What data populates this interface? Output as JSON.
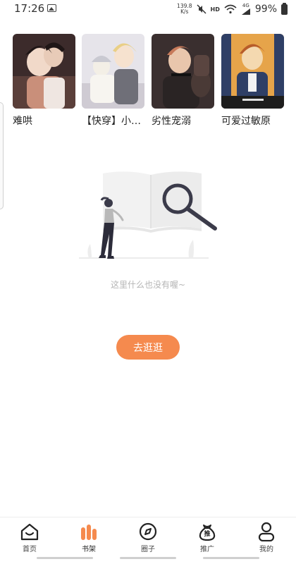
{
  "status_bar": {
    "time": "17:26",
    "net_speed_value": "139.8",
    "net_speed_unit": "K/s",
    "hd": "HD",
    "network": "4G",
    "battery": "99%"
  },
  "shelf": {
    "books": [
      {
        "title": "难哄",
        "cover_palette": [
          "#3c2b2b",
          "#c98f7a",
          "#f1d9c9"
        ]
      },
      {
        "title": "【快穿】小…",
        "cover_palette": [
          "#d9d9e2",
          "#f3efe6",
          "#6f6f78"
        ]
      },
      {
        "title": "劣性宠溺",
        "cover_palette": [
          "#3a2f2f",
          "#c77a5a",
          "#e9c6ac"
        ]
      },
      {
        "title": "可爱过敏原",
        "cover_palette": [
          "#2f3f66",
          "#e6a44a",
          "#f4d9b0"
        ]
      }
    ]
  },
  "empty_state": {
    "text": "这里什么也没有喔~",
    "button_label": "去逛逛"
  },
  "tab_bar": {
    "active_color": "#f58a4e",
    "tabs": [
      {
        "label": "首页",
        "icon": "home-icon"
      },
      {
        "label": "书架",
        "icon": "bookshelf-icon",
        "active": true
      },
      {
        "label": "圈子",
        "icon": "compass-icon"
      },
      {
        "label": "推广",
        "icon": "promo-bag-icon",
        "icon_text": "推"
      },
      {
        "label": "我的",
        "icon": "profile-icon"
      }
    ]
  },
  "colors": {
    "accent": "#f58a4e",
    "empty_text": "#b5b5b5"
  }
}
